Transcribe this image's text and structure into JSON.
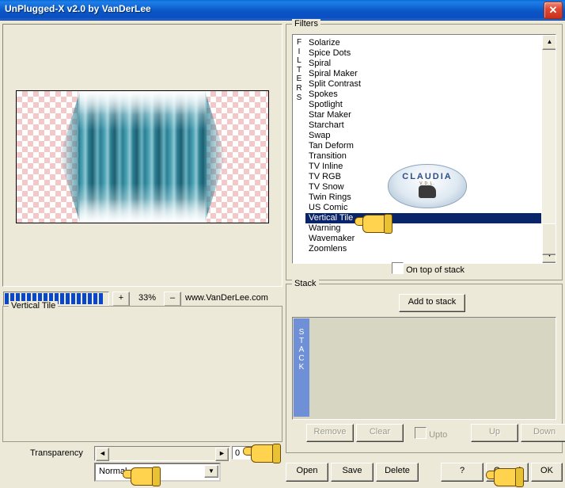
{
  "window": {
    "title": "UnPlugged-X v2.0 by VanDerLee",
    "close_label": "✕"
  },
  "preview": {
    "zoom_percent": "33%",
    "zoom_in_label": "+",
    "zoom_out_label": "–",
    "url": "www.VanDerLee.com"
  },
  "filter_settings": {
    "legend": "Vertical Tile"
  },
  "transparency": {
    "label": "Transparency",
    "left_arrow": "◄",
    "right_arrow": "►",
    "value": "0",
    "blend_mode": "Normal",
    "blend_arrow": "▼"
  },
  "filters": {
    "legend": "Filters",
    "sideword": "FILTERS",
    "items": [
      "Solarize",
      "Spice Dots",
      "Spiral",
      "Spiral Maker",
      "Split Contrast",
      "Spokes",
      "Spotlight",
      "Star Maker",
      "Starchart",
      "Swap",
      "Tan Deform",
      "Transition",
      "TV Inline",
      "TV RGB",
      "TV Snow",
      "Twin Rings",
      "US Comic",
      "Vertical Tile",
      "Warning",
      "Wavemaker",
      "Zoomlens"
    ],
    "selected": "Vertical Tile",
    "on_top_of_stack": "On top of stack",
    "scroll_up": "▲",
    "scroll_down": "▼"
  },
  "watermark": {
    "text": "CLAUDIA",
    "subtext": "V.D.L."
  },
  "stack": {
    "legend": "Stack",
    "add_to_stack": "Add to stack",
    "sideword": "STACK",
    "buttons": {
      "remove": "Remove",
      "clear": "Clear",
      "upto": "Upto",
      "up": "Up",
      "down": "Down"
    }
  },
  "bottom_buttons": {
    "open": "Open",
    "save": "Save",
    "delete": "Delete",
    "help": "?",
    "cancel": "Cancel",
    "ok": "OK"
  }
}
